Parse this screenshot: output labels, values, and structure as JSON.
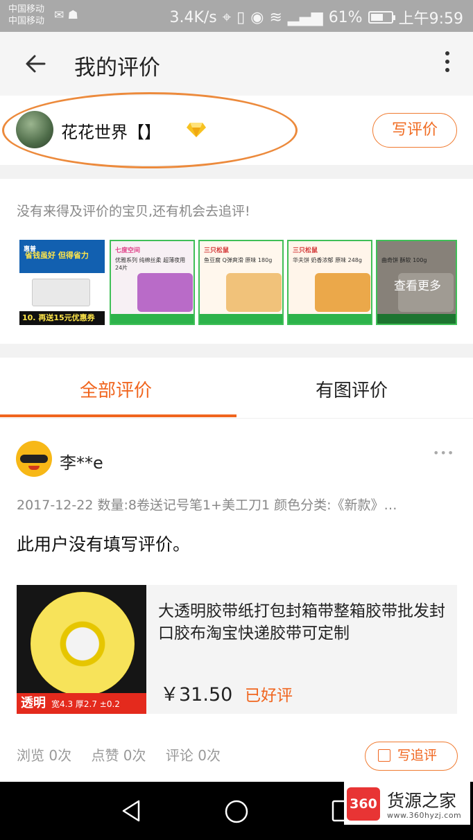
{
  "status_bar": {
    "carrier_1": "中国移动",
    "carrier_2": "中国移动",
    "speed": "3.4K/s",
    "battery": "61%",
    "battery_level": 0.61,
    "time": "上午9:59"
  },
  "title_bar": {
    "title": "我的评价"
  },
  "user": {
    "name": "花花世界【】",
    "write_review_label": "写评价"
  },
  "pending": {
    "prompt": "没有来得及评价的宝贝,还有机会去追评!",
    "see_more_label": "查看更多",
    "items": [
      {
        "brand": "惠普",
        "slogan": "省钱虽好 但得省力",
        "promo": "10. 再送15元优惠券"
      },
      {
        "brand": "七度空间",
        "text": "优雅系列 纯棉丝柔 超薄夜用 24片"
      },
      {
        "brand": "三只松鼠",
        "text": "鱼豆腐 Q弹爽滑 原味 180g"
      },
      {
        "brand": "三只松鼠",
        "text": "华夫饼 奶香浓郁 原味 248g"
      },
      {
        "brand": "",
        "text": "曲奇饼 酥软 100g"
      }
    ]
  },
  "tabs": [
    {
      "label": "全部评价",
      "active": true
    },
    {
      "label": "有图评价",
      "active": false
    }
  ],
  "review": {
    "author": "李**e",
    "date": "2017-12-22",
    "meta": "2017-12-22  数量:8卷送记号笔1+美工刀1 颜色分类:《新款》…",
    "content": "此用户没有填写评价。",
    "product": {
      "title": "大透明胶带纸打包封箱带整箱胶带批发封口胶布淘宝快递胶带可定制",
      "price": "￥31.50",
      "rating": "已好评",
      "image_label_main": "透明",
      "image_label_spec": "宽4.3 厚2.7 ±0.2"
    },
    "stats": {
      "views": "浏览 0次",
      "likes": "点赞 0次",
      "comments": "评论 0次"
    },
    "followup_label": "写追评"
  },
  "watermark": {
    "logo": "360",
    "name": "货源之家",
    "url": "www.360hyzj.com"
  },
  "colors": {
    "accent": "#f0651e",
    "highlight_circle": "#ec8a3c"
  }
}
